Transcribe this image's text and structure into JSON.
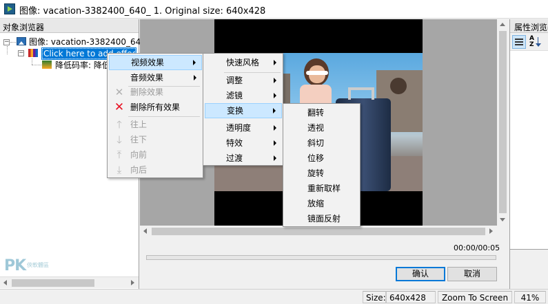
{
  "window": {
    "title": "图像: vacation-3382400_640_ 1. Original size: 640x428"
  },
  "object_browser": {
    "header": "对象浏览器",
    "root_label": "图像: vacation-3382400_64",
    "child_label": "Click here to add effect",
    "grandchild_label": "降低码率: 降低码率"
  },
  "property_browser": {
    "header": "属性浏览器"
  },
  "player": {
    "time": "00:00/00:05",
    "ok_label": "确认",
    "cancel_label": "取消"
  },
  "statusbar": {
    "size_label": "Size:",
    "size_value": "640x428",
    "zoom_button": "Zoom To Screen",
    "zoom_percent": "41%"
  },
  "watermark": {
    "logo": "PK",
    "tagline": "俠軟體區"
  },
  "context_menu": {
    "items": [
      {
        "label": "视频效果",
        "has_submenu": true,
        "highlighted": true
      },
      {
        "label": "音频效果",
        "has_submenu": true
      },
      {
        "label": "删除效果",
        "disabled": true,
        "icon": "x-icon"
      },
      {
        "label": "删除所有效果",
        "icon": "red-x-icon"
      },
      {
        "label": "往上",
        "disabled": true,
        "icon": "arrow-up-icon"
      },
      {
        "label": "往下",
        "disabled": true,
        "icon": "arrow-down-icon"
      },
      {
        "label": "向前",
        "disabled": true,
        "icon": "arrow-up-bar-icon"
      },
      {
        "label": "向后",
        "disabled": true,
        "icon": "arrow-down-bar-icon"
      }
    ]
  },
  "video_effects_menu": {
    "items": [
      {
        "label": "快速风格",
        "has_submenu": true
      },
      {
        "label": "调整",
        "has_submenu": true
      },
      {
        "label": "滤镜",
        "has_submenu": true
      },
      {
        "label": "变换",
        "has_submenu": true,
        "highlighted": true
      },
      {
        "label": "透明度",
        "has_submenu": true
      },
      {
        "label": "特效",
        "has_submenu": true
      },
      {
        "label": "过渡",
        "has_submenu": true
      }
    ]
  },
  "transform_menu": {
    "items": [
      {
        "label": "翻转"
      },
      {
        "label": "透视"
      },
      {
        "label": "斜切"
      },
      {
        "label": "位移"
      },
      {
        "label": "旋转"
      },
      {
        "label": "重新取样"
      },
      {
        "label": "放缩"
      },
      {
        "label": "镜面反射"
      }
    ]
  },
  "colors": {
    "selection": "#0078d7",
    "menu_highlight": "#cce8ff",
    "delete_red": "#e81123"
  }
}
